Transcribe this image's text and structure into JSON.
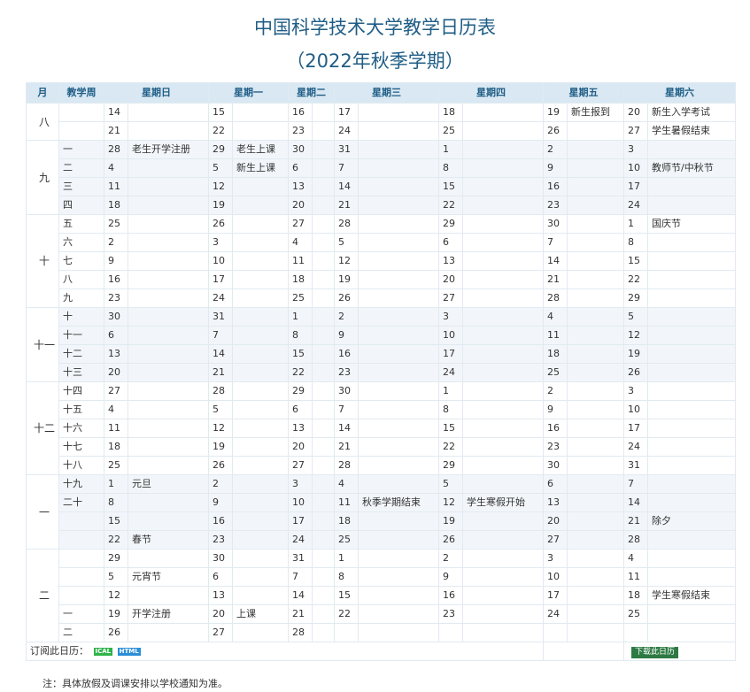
{
  "header": {
    "title": "中国科学技术大学教学日历表",
    "subtitle": "（2022年秋季学期）"
  },
  "columns": [
    "月",
    "教学周",
    "星期日",
    "星期一",
    "星期二",
    "星期三",
    "星期四",
    "星期五",
    "星期六"
  ],
  "months": [
    {
      "label": "八",
      "rows": [
        {
          "week": "",
          "days": [
            [
              "14",
              ""
            ],
            [
              "15",
              ""
            ],
            [
              "16",
              ""
            ],
            [
              "17",
              ""
            ],
            [
              "18",
              ""
            ],
            [
              "19",
              "新生报到"
            ],
            [
              "20",
              "新生入学考试"
            ]
          ]
        },
        {
          "week": "",
          "days": [
            [
              "21",
              ""
            ],
            [
              "22",
              ""
            ],
            [
              "23",
              ""
            ],
            [
              "24",
              ""
            ],
            [
              "25",
              ""
            ],
            [
              "26",
              ""
            ],
            [
              "27",
              "学生暑假结束"
            ]
          ]
        }
      ]
    },
    {
      "label": "九",
      "rows": [
        {
          "week": "一",
          "days": [
            [
              "28",
              "老生开学注册"
            ],
            [
              "29",
              "老生上课"
            ],
            [
              "30",
              ""
            ],
            [
              "31",
              ""
            ],
            [
              "1",
              ""
            ],
            [
              "2",
              ""
            ],
            [
              "3",
              ""
            ]
          ]
        },
        {
          "week": "二",
          "days": [
            [
              "4",
              ""
            ],
            [
              "5",
              "新生上课"
            ],
            [
              "6",
              ""
            ],
            [
              "7",
              ""
            ],
            [
              "8",
              ""
            ],
            [
              "9",
              ""
            ],
            [
              "10",
              "教师节/中秋节"
            ]
          ]
        },
        {
          "week": "三",
          "days": [
            [
              "11",
              ""
            ],
            [
              "12",
              ""
            ],
            [
              "13",
              ""
            ],
            [
              "14",
              ""
            ],
            [
              "15",
              ""
            ],
            [
              "16",
              ""
            ],
            [
              "17",
              ""
            ]
          ]
        },
        {
          "week": "四",
          "days": [
            [
              "18",
              ""
            ],
            [
              "19",
              ""
            ],
            [
              "20",
              ""
            ],
            [
              "21",
              ""
            ],
            [
              "22",
              ""
            ],
            [
              "23",
              ""
            ],
            [
              "24",
              ""
            ]
          ]
        }
      ]
    },
    {
      "label": "十",
      "rows": [
        {
          "week": "五",
          "days": [
            [
              "25",
              ""
            ],
            [
              "26",
              ""
            ],
            [
              "27",
              ""
            ],
            [
              "28",
              ""
            ],
            [
              "29",
              ""
            ],
            [
              "30",
              ""
            ],
            [
              "1",
              "国庆节"
            ]
          ]
        },
        {
          "week": "六",
          "days": [
            [
              "2",
              ""
            ],
            [
              "3",
              ""
            ],
            [
              "4",
              ""
            ],
            [
              "5",
              ""
            ],
            [
              "6",
              ""
            ],
            [
              "7",
              ""
            ],
            [
              "8",
              ""
            ]
          ]
        },
        {
          "week": "七",
          "days": [
            [
              "9",
              ""
            ],
            [
              "10",
              ""
            ],
            [
              "11",
              ""
            ],
            [
              "12",
              ""
            ],
            [
              "13",
              ""
            ],
            [
              "14",
              ""
            ],
            [
              "15",
              ""
            ]
          ]
        },
        {
          "week": "八",
          "days": [
            [
              "16",
              ""
            ],
            [
              "17",
              ""
            ],
            [
              "18",
              ""
            ],
            [
              "19",
              ""
            ],
            [
              "20",
              ""
            ],
            [
              "21",
              ""
            ],
            [
              "22",
              ""
            ]
          ]
        },
        {
          "week": "九",
          "days": [
            [
              "23",
              ""
            ],
            [
              "24",
              ""
            ],
            [
              "25",
              ""
            ],
            [
              "26",
              ""
            ],
            [
              "27",
              ""
            ],
            [
              "28",
              ""
            ],
            [
              "29",
              ""
            ]
          ]
        }
      ]
    },
    {
      "label": "十一",
      "rows": [
        {
          "week": "十",
          "days": [
            [
              "30",
              ""
            ],
            [
              "31",
              ""
            ],
            [
              "1",
              ""
            ],
            [
              "2",
              ""
            ],
            [
              "3",
              ""
            ],
            [
              "4",
              ""
            ],
            [
              "5",
              ""
            ]
          ]
        },
        {
          "week": "十一",
          "days": [
            [
              "6",
              ""
            ],
            [
              "7",
              ""
            ],
            [
              "8",
              ""
            ],
            [
              "9",
              ""
            ],
            [
              "10",
              ""
            ],
            [
              "11",
              ""
            ],
            [
              "12",
              ""
            ]
          ]
        },
        {
          "week": "十二",
          "days": [
            [
              "13",
              ""
            ],
            [
              "14",
              ""
            ],
            [
              "15",
              ""
            ],
            [
              "16",
              ""
            ],
            [
              "17",
              ""
            ],
            [
              "18",
              ""
            ],
            [
              "19",
              ""
            ]
          ]
        },
        {
          "week": "十三",
          "days": [
            [
              "20",
              ""
            ],
            [
              "21",
              ""
            ],
            [
              "22",
              ""
            ],
            [
              "23",
              ""
            ],
            [
              "24",
              ""
            ],
            [
              "25",
              ""
            ],
            [
              "26",
              ""
            ]
          ]
        }
      ]
    },
    {
      "label": "十二",
      "rows": [
        {
          "week": "十四",
          "days": [
            [
              "27",
              ""
            ],
            [
              "28",
              ""
            ],
            [
              "29",
              ""
            ],
            [
              "30",
              ""
            ],
            [
              "1",
              ""
            ],
            [
              "2",
              ""
            ],
            [
              "3",
              ""
            ]
          ]
        },
        {
          "week": "十五",
          "days": [
            [
              "4",
              ""
            ],
            [
              "5",
              ""
            ],
            [
              "6",
              ""
            ],
            [
              "7",
              ""
            ],
            [
              "8",
              ""
            ],
            [
              "9",
              ""
            ],
            [
              "10",
              ""
            ]
          ]
        },
        {
          "week": "十六",
          "days": [
            [
              "11",
              ""
            ],
            [
              "12",
              ""
            ],
            [
              "13",
              ""
            ],
            [
              "14",
              ""
            ],
            [
              "15",
              ""
            ],
            [
              "16",
              ""
            ],
            [
              "17",
              ""
            ]
          ]
        },
        {
          "week": "十七",
          "days": [
            [
              "18",
              ""
            ],
            [
              "19",
              ""
            ],
            [
              "20",
              ""
            ],
            [
              "21",
              ""
            ],
            [
              "22",
              ""
            ],
            [
              "23",
              ""
            ],
            [
              "24",
              ""
            ]
          ]
        },
        {
          "week": "十八",
          "days": [
            [
              "25",
              ""
            ],
            [
              "26",
              ""
            ],
            [
              "27",
              ""
            ],
            [
              "28",
              ""
            ],
            [
              "29",
              ""
            ],
            [
              "30",
              ""
            ],
            [
              "31",
              ""
            ]
          ]
        }
      ]
    },
    {
      "label": "一",
      "rows": [
        {
          "week": "十九",
          "days": [
            [
              "1",
              "元旦"
            ],
            [
              "2",
              ""
            ],
            [
              "3",
              ""
            ],
            [
              "4",
              ""
            ],
            [
              "5",
              ""
            ],
            [
              "6",
              ""
            ],
            [
              "7",
              ""
            ]
          ]
        },
        {
          "week": "二十",
          "days": [
            [
              "8",
              ""
            ],
            [
              "9",
              ""
            ],
            [
              "10",
              ""
            ],
            [
              "11",
              "秋季学期结束"
            ],
            [
              "12",
              "学生寒假开始"
            ],
            [
              "13",
              ""
            ],
            [
              "14",
              ""
            ]
          ]
        },
        {
          "week": "",
          "days": [
            [
              "15",
              ""
            ],
            [
              "16",
              ""
            ],
            [
              "17",
              ""
            ],
            [
              "18",
              ""
            ],
            [
              "19",
              ""
            ],
            [
              "20",
              ""
            ],
            [
              "21",
              "除夕"
            ]
          ]
        },
        {
          "week": "",
          "days": [
            [
              "22",
              "春节"
            ],
            [
              "23",
              ""
            ],
            [
              "24",
              ""
            ],
            [
              "25",
              ""
            ],
            [
              "26",
              ""
            ],
            [
              "27",
              ""
            ],
            [
              "28",
              ""
            ]
          ]
        }
      ]
    },
    {
      "label": "二",
      "rows": [
        {
          "week": "",
          "days": [
            [
              "29",
              ""
            ],
            [
              "30",
              ""
            ],
            [
              "31",
              ""
            ],
            [
              "1",
              ""
            ],
            [
              "2",
              ""
            ],
            [
              "3",
              ""
            ],
            [
              "4",
              ""
            ]
          ]
        },
        {
          "week": "",
          "days": [
            [
              "5",
              "元宵节"
            ],
            [
              "6",
              ""
            ],
            [
              "7",
              ""
            ],
            [
              "8",
              ""
            ],
            [
              "9",
              ""
            ],
            [
              "10",
              ""
            ],
            [
              "11",
              ""
            ]
          ]
        },
        {
          "week": "",
          "days": [
            [
              "12",
              ""
            ],
            [
              "13",
              ""
            ],
            [
              "14",
              ""
            ],
            [
              "15",
              ""
            ],
            [
              "16",
              ""
            ],
            [
              "17",
              ""
            ],
            [
              "18",
              "学生寒假结束"
            ]
          ]
        },
        {
          "week": "一",
          "days": [
            [
              "19",
              "开学注册"
            ],
            [
              "20",
              "上课"
            ],
            [
              "21",
              ""
            ],
            [
              "22",
              ""
            ],
            [
              "23",
              ""
            ],
            [
              "24",
              ""
            ],
            [
              "25",
              ""
            ]
          ]
        },
        {
          "week": "二",
          "days": [
            [
              "26",
              ""
            ],
            [
              "27",
              ""
            ],
            [
              "28",
              ""
            ],
            [
              "",
              ""
            ],
            [
              "",
              ""
            ],
            [
              "",
              ""
            ],
            [
              "",
              ""
            ]
          ]
        }
      ]
    }
  ],
  "footer": {
    "subscribe_label": "订阅此日历：",
    "ical_label": "ICAL",
    "html_label": "HTML",
    "download_label": "下载此日历"
  },
  "note": "注：具体放假及调课安排以学校通知为准。"
}
